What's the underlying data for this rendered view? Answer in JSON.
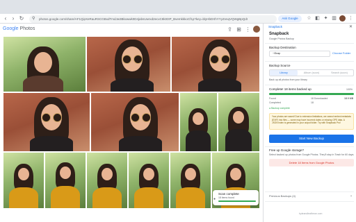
{
  "browser": {
    "url": "photos.google.com/share/AF1QipXeRauRSCGBxdTmdJw3Bkxwwk0D4jabsUwrxd2ecxC8ktGtP_BvemkkkoCf1p?key=blyHbDXhYYyZvnqVQWgBpQdIcoTkvBLV3a2tm8KKe1ndNY",
    "ask_label": "Ask Google"
  },
  "photos_app": {
    "logo_google": "Google",
    "logo_photos": "Photos"
  },
  "toast": {
    "title": "Scan complete",
    "subtitle": "18 items found",
    "progress": 1.0
  },
  "panel": {
    "header_title": "Snapback",
    "title": "Snapback",
    "subtitle": "Google Photos Backup",
    "destination": {
      "label": "Backup Destination",
      "value": "~/Snap",
      "button": "Choose Folder"
    },
    "source": {
      "label": "Backup Source",
      "tabs": [
        "Library",
        "Album (soon)",
        "Search (soon)"
      ],
      "active_tab": 0,
      "note": "Back up all photos from your library"
    },
    "progress": {
      "label": "Complete! 18 items backed up",
      "percent_text": "100%",
      "fraction": 1.0
    },
    "stats": [
      {
        "label": "Found",
        "mid": "18 Downloaded",
        "right": "18.9 MB"
      },
      {
        "label": "Completed",
        "mid": "18",
        "right": ""
      }
    ],
    "status": "Backup complete",
    "warning": "Your photos are saved! Due to extension limitations, we cannot embed metadata (EXIF) into files — some may have incorrect dates or missing GPS data. A JSON index is generated in your output folder. Try with Snapback Pro!",
    "start_button": "Start New Backup",
    "free_up": {
      "label": "Free up Google storage?",
      "note": "Select backed up photos from Google Photos. They'll stay in Trash for 60 days."
    },
    "delete_button": "Delete 18 Items from Google Photos",
    "previous_backups": "Previous Backups (4)",
    "footer": "byteandleafbean.com"
  }
}
